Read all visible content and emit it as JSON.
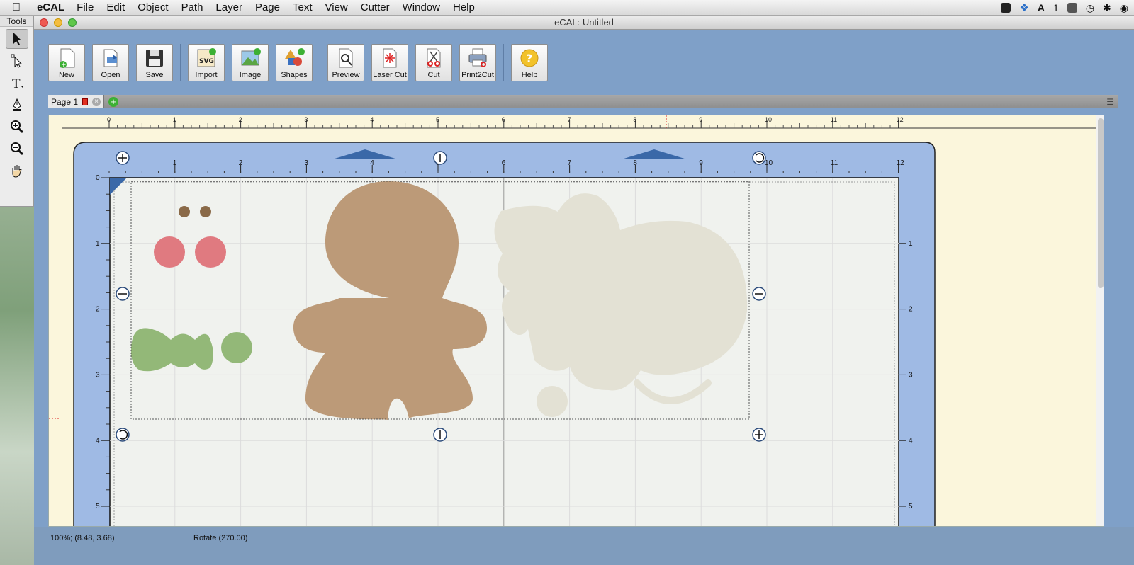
{
  "menubar": {
    "items": [
      "eCAL",
      "File",
      "Edit",
      "Object",
      "Path",
      "Layer",
      "Page",
      "Text",
      "View",
      "Cutter",
      "Window",
      "Help"
    ],
    "status_count": "1"
  },
  "tools": {
    "title": "Tools",
    "items": [
      "arrow-select",
      "direct-select",
      "text",
      "pen",
      "zoom-in",
      "zoom-out",
      "hand"
    ]
  },
  "window": {
    "title": "eCAL: Untitled"
  },
  "toolbar": [
    {
      "label": "New"
    },
    {
      "label": "Open"
    },
    {
      "label": "Save"
    },
    {
      "label": "Import"
    },
    {
      "label": "Image"
    },
    {
      "label": "Shapes"
    },
    {
      "label": "Preview"
    },
    {
      "label": "Laser Cut"
    },
    {
      "label": "Cut"
    },
    {
      "label": "Print2Cut"
    },
    {
      "label": "Help"
    }
  ],
  "pagetabs": {
    "tab_label": "Page 1"
  },
  "rulers": {
    "top": [
      "0",
      "1",
      "2",
      "3",
      "4",
      "5",
      "6",
      "7",
      "8",
      "9",
      "10",
      "11",
      "12"
    ],
    "mat_top": [
      "1",
      "2",
      "3",
      "4",
      "5",
      "6",
      "7",
      "8",
      "9",
      "10",
      "11",
      "12"
    ],
    "left": [
      "0",
      "1",
      "2",
      "3",
      "4",
      "5"
    ],
    "right": [
      "1",
      "2",
      "3",
      "4",
      "5"
    ]
  },
  "statusbar": {
    "zoom_coords": "100%; (8.48, 3.68)",
    "action": "Rotate (270.00)"
  },
  "colors": {
    "cookie": "#bc9a78",
    "cheek": "#e07a80",
    "eye": "#8a6a48",
    "bowtie": "#93b878",
    "ghost": "#e3e1d4",
    "mat": "#9fbae4",
    "accent": "#3a68a8"
  }
}
